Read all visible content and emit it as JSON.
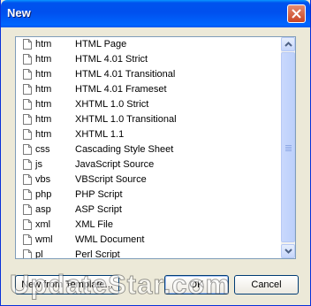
{
  "window": {
    "title": "New"
  },
  "file_types": [
    {
      "ext": "htm",
      "desc": "HTML Page"
    },
    {
      "ext": "htm",
      "desc": "HTML 4.01 Strict"
    },
    {
      "ext": "htm",
      "desc": "HTML 4.01 Transitional"
    },
    {
      "ext": "htm",
      "desc": "HTML 4.01 Frameset"
    },
    {
      "ext": "htm",
      "desc": "XHTML 1.0 Strict"
    },
    {
      "ext": "htm",
      "desc": "XHTML 1.0 Transitional"
    },
    {
      "ext": "htm",
      "desc": "XHTML 1.1"
    },
    {
      "ext": "css",
      "desc": "Cascading Style Sheet"
    },
    {
      "ext": "js",
      "desc": "JavaScript Source"
    },
    {
      "ext": "vbs",
      "desc": "VBScript Source"
    },
    {
      "ext": "php",
      "desc": "PHP Script"
    },
    {
      "ext": "asp",
      "desc": "ASP Script"
    },
    {
      "ext": "xml",
      "desc": "XML File"
    },
    {
      "ext": "wml",
      "desc": "WML Document"
    },
    {
      "ext": "pl",
      "desc": "Perl Script"
    }
  ],
  "buttons": {
    "from_template": "New from Template...",
    "ok": "OK",
    "cancel": "Cancel"
  },
  "watermark": "UpdateStar.com",
  "icons": {
    "close": "close-icon",
    "file": "file-icon",
    "up": "scroll-up-arrow-icon",
    "down": "scroll-down-arrow-icon"
  }
}
